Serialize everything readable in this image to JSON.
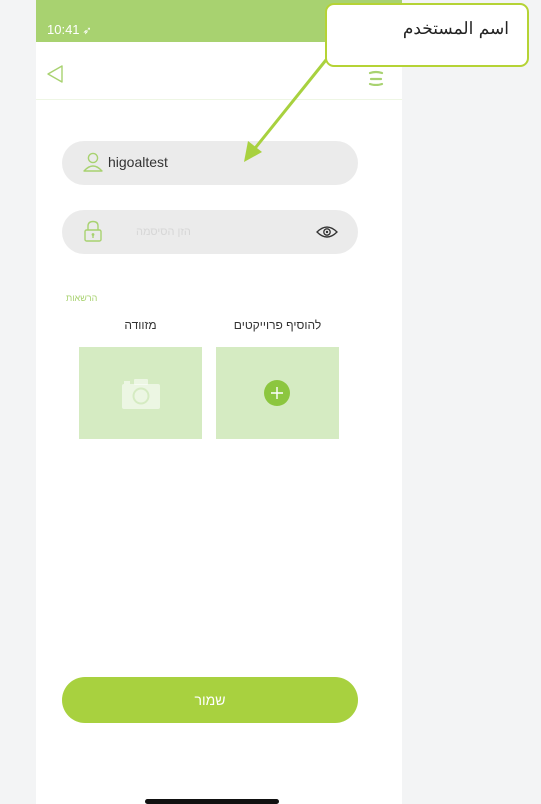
{
  "status_bar": {
    "time": "10:41",
    "location_glyph": "➶",
    "background": "#a8d270"
  },
  "header": {
    "back_icon": "back-triangle-icon",
    "menu_icon": "menu-icon"
  },
  "username": {
    "value": "higoaltest",
    "icon": "user-icon"
  },
  "password": {
    "placeholder": "הזן הסיסמה",
    "icon": "lock-icon",
    "toggle_icon": "eye-icon"
  },
  "permissions": {
    "label": "הרשאות"
  },
  "cards": {
    "left_label": "מזוודה",
    "left_icon": "camera-icon",
    "right_label": "להוסיף פרוייקטים",
    "right_icon": "plus-circle-icon"
  },
  "save_label": "שמור",
  "callout": {
    "text": "اسم المستخدم"
  },
  "colors": {
    "accent": "#a8d13f",
    "card": "#d5ebc2",
    "field": "#ebebeb",
    "callout_border": "#b5d335"
  }
}
